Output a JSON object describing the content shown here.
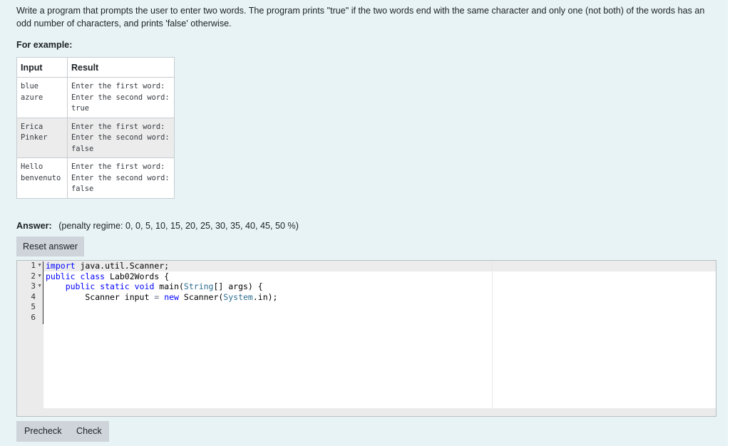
{
  "question": {
    "text": "Write a program that prompts the user to enter two words. The program prints \"true\" if the two words end with the same character and only one (not both) of the words has an odd number of characters, and prints 'false' otherwise.",
    "for_example_label": "For example:"
  },
  "examples": {
    "headers": [
      "Input",
      "Result"
    ],
    "rows": [
      {
        "input": "blue\nazure",
        "result": "Enter the first word:\nEnter the second word:\ntrue"
      },
      {
        "input": "Erica\nPinker",
        "result": "Enter the first word:\nEnter the second word:\nfalse"
      },
      {
        "input": "Hello\nbenvenuto",
        "result": "Enter the first word:\nEnter the second word:\nfalse"
      }
    ]
  },
  "answer": {
    "label": "Answer:",
    "penalty": "(penalty regime: 0, 0, 5, 10, 15, 20, 25, 30, 35, 40, 45, 50 %)"
  },
  "buttons": {
    "reset": "Reset answer",
    "precheck": "Precheck",
    "check": "Check"
  },
  "editor": {
    "line_numbers": [
      "1",
      "2",
      "3",
      "4",
      "5",
      "6"
    ],
    "fold_markers": [
      "1",
      "2",
      "3"
    ],
    "code": {
      "line1_kw": "import",
      "line1_rest": " java.util.Scanner;",
      "line2_kw1": "public",
      "line2_kw2": "class",
      "line2_rest": " Lab02Words {",
      "line3_indent": "    ",
      "line3_kw1": "public",
      "line3_kw2": "static",
      "line3_kw3": "void",
      "line3_mid": " main(",
      "line3_type": "String",
      "line3_end": "[] args) {",
      "line4_start": "        Scanner input ",
      "line4_eq": "=",
      "line4_new": "new",
      "line4_sc": " Scanner(",
      "line4_sys": "System",
      "line4_end": ".in);"
    }
  }
}
